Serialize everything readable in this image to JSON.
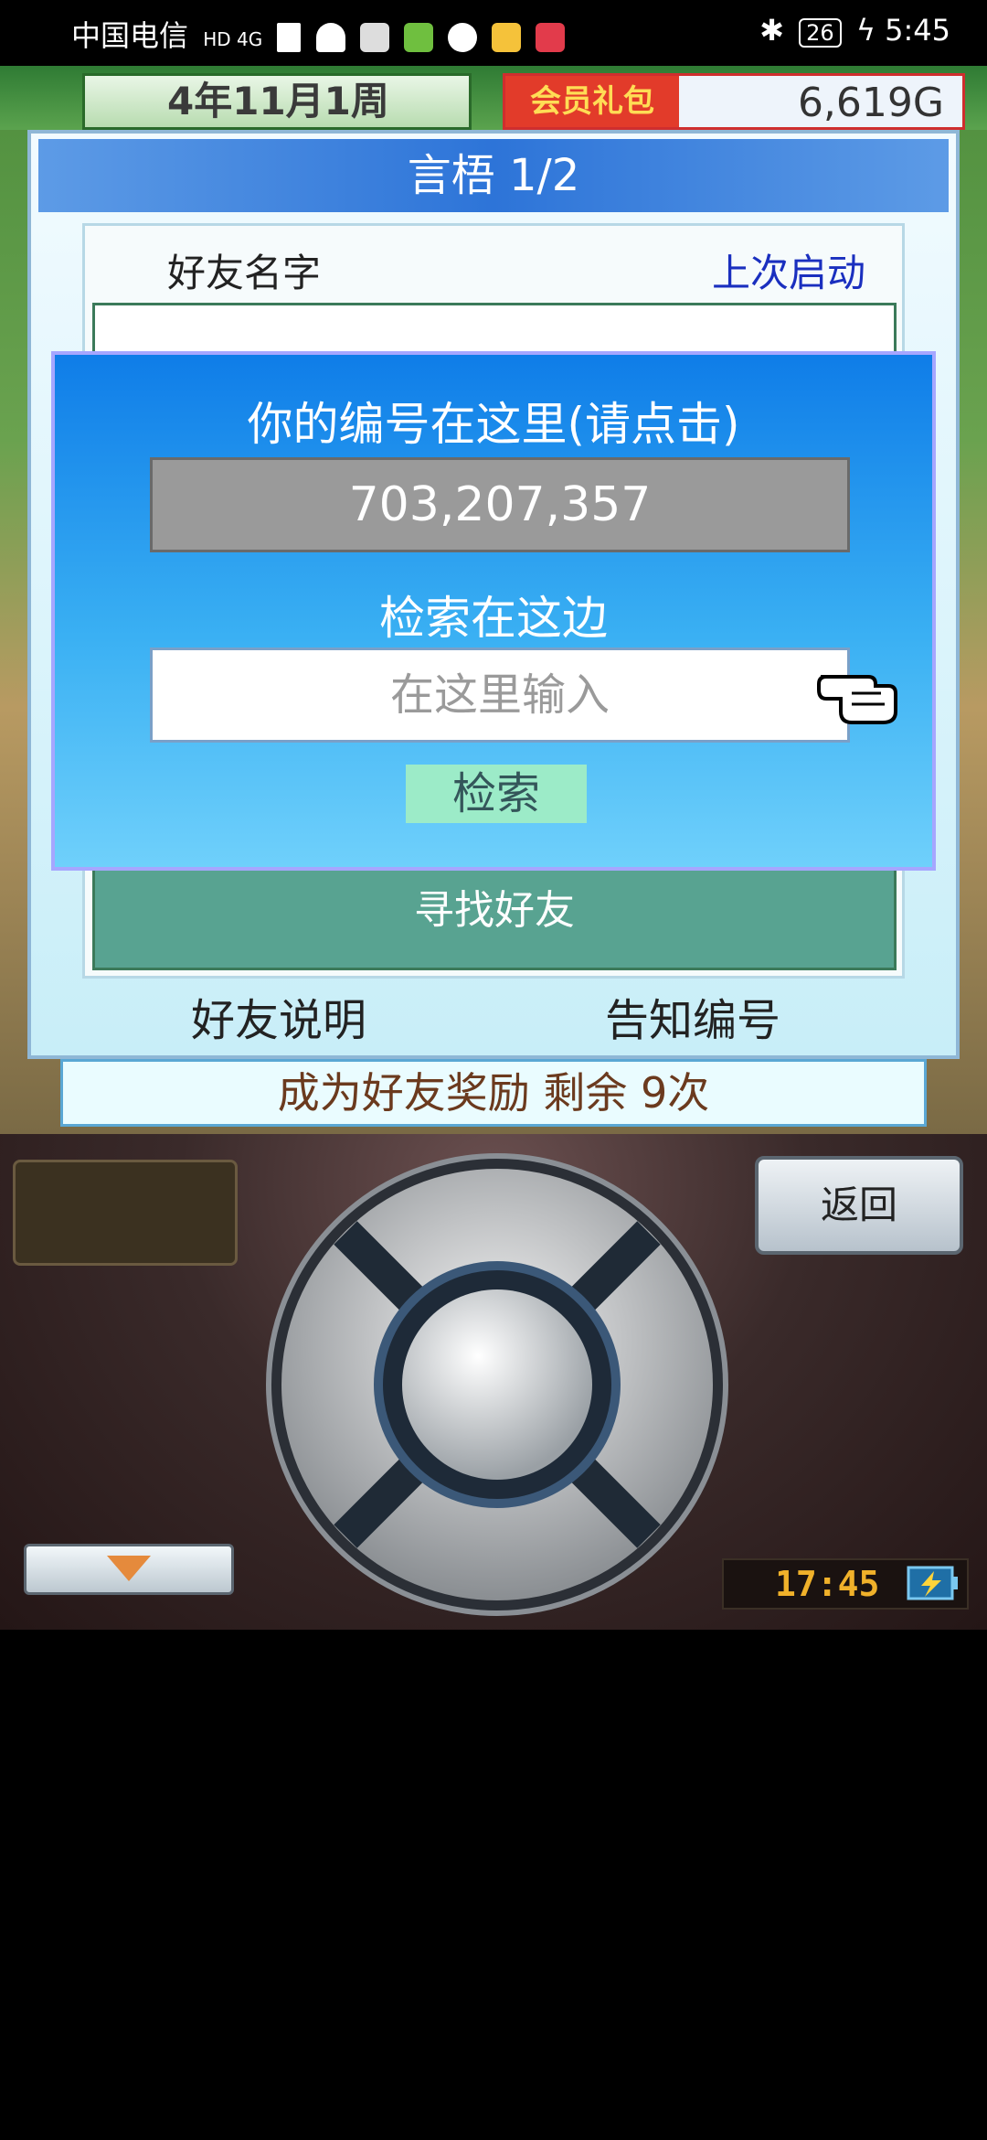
{
  "status_bar": {
    "carrier": "中国电信",
    "network": "HD 4G",
    "battery": "26",
    "time": "5:45"
  },
  "game_top": {
    "date": "4年11月1周",
    "gift_label": "会员礼包",
    "money": "6,619G"
  },
  "dialog": {
    "title": "言梧 1/2",
    "col_name": "好友名字",
    "col_last": "上次启动",
    "find_friend": "寻找好友",
    "friend_help": "好友说明",
    "notify_id": "告知编号",
    "reward": "成为好友奖励 剩余 9次"
  },
  "popup": {
    "hint": "你的编号在这里(请点击)",
    "my_id": "703,207,357",
    "search_label": "检索在这边",
    "search_placeholder": "在这里输入",
    "search_button": "检索"
  },
  "controller": {
    "back": "返回",
    "clock": "17:45"
  },
  "icons": [
    "bluetooth-icon",
    "wifi-icon",
    "signal-icon",
    "battery-icon",
    "pointer-hand-icon",
    "dpad-icon",
    "down-arrow-icon",
    "charging-icon"
  ]
}
